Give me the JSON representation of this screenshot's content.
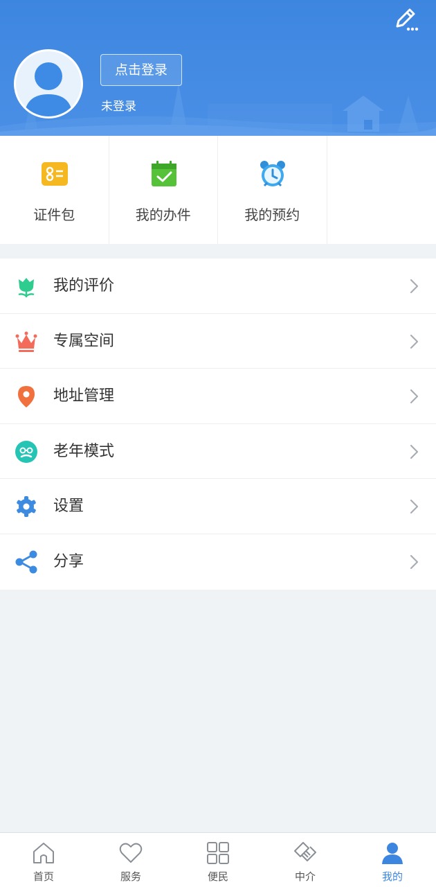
{
  "header": {
    "login_button": "点击登录",
    "login_status": "未登录",
    "background_color": "#3d86e0"
  },
  "quick_actions": [
    {
      "label": "证件包",
      "icon": "id-card-icon",
      "color": "#f6b820"
    },
    {
      "label": "我的办件",
      "icon": "calendar-check-icon",
      "color": "#55c23a"
    },
    {
      "label": "我的预约",
      "icon": "alarm-clock-icon",
      "color": "#3fa9f0"
    }
  ],
  "menu": [
    {
      "label": "我的评价",
      "icon": "flower-icon",
      "color": "#2ecc8f"
    },
    {
      "label": "专属空间",
      "icon": "crown-icon",
      "color": "#f26b5b"
    },
    {
      "label": "地址管理",
      "icon": "location-pin-icon",
      "color": "#f0703e"
    },
    {
      "label": "老年模式",
      "icon": "elder-face-icon",
      "color": "#26c4b5"
    },
    {
      "label": "设置",
      "icon": "gear-icon",
      "color": "#3d8be0"
    },
    {
      "label": "分享",
      "icon": "share-icon",
      "color": "#3d8be0"
    }
  ],
  "tabbar": {
    "active_color": "#3d86e0",
    "tabs": [
      {
        "label": "首页",
        "icon": "home-icon",
        "active": false
      },
      {
        "label": "服务",
        "icon": "heart-icon",
        "active": false
      },
      {
        "label": "便民",
        "icon": "grid-icon",
        "active": false
      },
      {
        "label": "中介",
        "icon": "handshake-icon",
        "active": false
      },
      {
        "label": "我的",
        "icon": "user-icon",
        "active": true
      }
    ]
  }
}
